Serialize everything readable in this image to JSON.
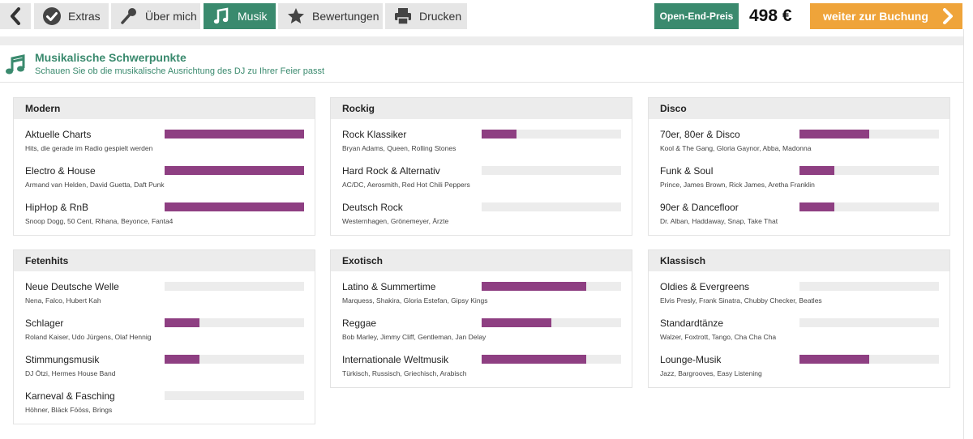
{
  "toolbar": {
    "tabs": [
      {
        "label": "Extras",
        "icon": "checkmark-badge-icon"
      },
      {
        "label": "Über mich",
        "icon": "microphone-icon"
      },
      {
        "label": "Musik",
        "icon": "music-note-icon",
        "active": true
      },
      {
        "label": "Bewertungen",
        "icon": "star-icon"
      },
      {
        "label": "Drucken",
        "icon": "printer-icon"
      }
    ],
    "price_badge": "Open-End-Preis",
    "price": "498 €",
    "booking_label": "weiter zur Buchung"
  },
  "section": {
    "title": "Musikalische Schwerpunkte",
    "subtitle": "Schauen Sie ob die musikalische Ausrichtung des DJ zu Ihrer Feier passt"
  },
  "colors": {
    "accent": "#3a8a6e",
    "bar": "#8e3f82",
    "booking": "#efa43a",
    "bar_track": "#ececec"
  },
  "categories": [
    {
      "title": "Modern",
      "items": [
        {
          "name": "Aktuelle Charts",
          "desc": "Hits, die gerade im Radio gespielt werden",
          "level": 1.0
        },
        {
          "name": "Electro & House",
          "desc": "Armand van Helden, David Guetta, Daft Punk",
          "level": 1.0
        },
        {
          "name": "HipHop & RnB",
          "desc": "Snoop Dogg, 50 Cent, Rihana, Beyonce, Fanta4",
          "level": 1.0
        }
      ]
    },
    {
      "title": "Rockig",
      "items": [
        {
          "name": "Rock Klassiker",
          "desc": "Bryan Adams, Queen, Rolling Stones",
          "level": 0.25
        },
        {
          "name": "Hard Rock & Alternativ",
          "desc": "AC/DC, Aerosmith, Red Hot Chili Peppers",
          "level": 0
        },
        {
          "name": "Deutsch Rock",
          "desc": "Westernhagen, Grönemeyer, Ärzte",
          "level": 0
        }
      ]
    },
    {
      "title": "Disco",
      "items": [
        {
          "name": "70er, 80er & Disco",
          "desc": "Kool & The Gang, Gloria Gaynor, Abba, Madonna",
          "level": 0.5
        },
        {
          "name": "Funk & Soul",
          "desc": "Prince, James Brown, Rick James, Aretha Franklin",
          "level": 0.25
        },
        {
          "name": "90er & Dancefloor",
          "desc": "Dr. Alban, Haddaway, Snap, Take That",
          "level": 0.25
        }
      ]
    },
    {
      "title": "Fetenhits",
      "items": [
        {
          "name": "Neue Deutsche Welle",
          "desc": "Nena, Falco, Hubert Kah",
          "level": 0
        },
        {
          "name": "Schlager",
          "desc": "Roland Kaiser, Udo Jürgens, Olaf Hennig",
          "level": 0.25
        },
        {
          "name": "Stimmungsmusik",
          "desc": "DJ Ötzi, Hermes House Band",
          "level": 0.25
        },
        {
          "name": "Karneval & Fasching",
          "desc": "Höhner, Bläck Fööss, Brings",
          "level": 0
        }
      ]
    },
    {
      "title": "Exotisch",
      "items": [
        {
          "name": "Latino & Summertime",
          "desc": "Marquess, Shakira, Gloria Estefan, Gipsy Kings",
          "level": 0.75
        },
        {
          "name": "Reggae",
          "desc": "Bob Marley, Jimmy Cliff, Gentleman, Jan Delay",
          "level": 0.5
        },
        {
          "name": "Internationale Weltmusik",
          "desc": "Türkisch, Russisch, Griechisch, Arabisch",
          "level": 0.75
        }
      ]
    },
    {
      "title": "Klassisch",
      "items": [
        {
          "name": "Oldies & Evergreens",
          "desc": "Elvis Presly, Frank Sinatra, Chubby Checker, Beatles",
          "level": 0
        },
        {
          "name": "Standardtänze",
          "desc": "Walzer, Foxtrott, Tango, Cha Cha Cha",
          "level": 0
        },
        {
          "name": "Lounge-Musik",
          "desc": "Jazz, Bargrooves, Easy Listening",
          "level": 0.5
        }
      ]
    }
  ]
}
